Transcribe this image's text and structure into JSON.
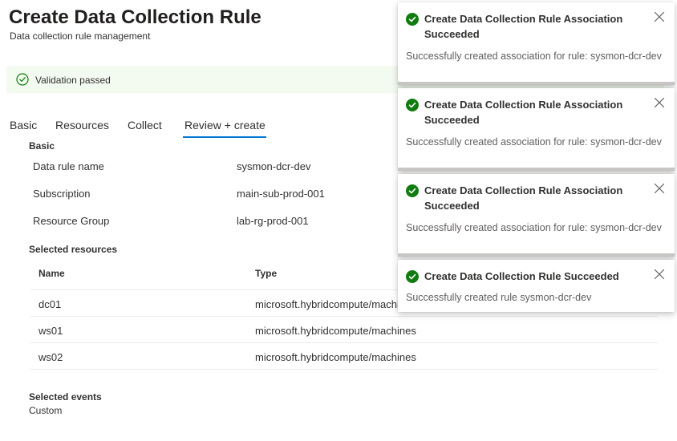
{
  "page": {
    "title": "Create Data Collection Rule",
    "subtitle": "Data collection rule management"
  },
  "validation": {
    "text": "Validation passed",
    "icon": "check-circle-icon",
    "color": "#107c10"
  },
  "tabs": [
    {
      "label": "Basic",
      "active": false
    },
    {
      "label": "Resources",
      "active": false
    },
    {
      "label": "Collect",
      "active": false
    },
    {
      "label": "Review + create",
      "active": true
    }
  ],
  "basic": {
    "heading": "Basic",
    "fields": [
      {
        "label": "Data rule name",
        "value": "sysmon-dcr-dev"
      },
      {
        "label": "Subscription",
        "value": "main-sub-prod-001"
      },
      {
        "label": "Resource Group",
        "value": "lab-rg-prod-001"
      }
    ]
  },
  "resources": {
    "heading": "Selected resources",
    "columns": [
      "Name",
      "Type"
    ],
    "rows": [
      {
        "name": "dc01",
        "type": "microsoft.hybridcompute/machines"
      },
      {
        "name": "ws01",
        "type": "microsoft.hybridcompute/machines"
      },
      {
        "name": "ws02",
        "type": "microsoft.hybridcompute/machines"
      }
    ]
  },
  "events": {
    "heading": "Selected events",
    "value": "Custom"
  },
  "notifications": [
    {
      "title": "Create Data Collection Rule Association Succeeded",
      "body": "Successfully created association for rule: sysmon-dcr-dev"
    },
    {
      "title": "Create Data Collection Rule Association Succeeded",
      "body": "Successfully created association for rule: sysmon-dcr-dev"
    },
    {
      "title": "Create Data Collection Rule Association Succeeded",
      "body": "Successfully created association for rule: sysmon-dcr-dev"
    },
    {
      "title": "Create Data Collection Rule Succeeded",
      "body": "Successfully created rule sysmon-dcr-dev"
    }
  ],
  "colors": {
    "success": "#107c10",
    "accent": "#0078d4",
    "validation_bg": "#f3faef"
  }
}
